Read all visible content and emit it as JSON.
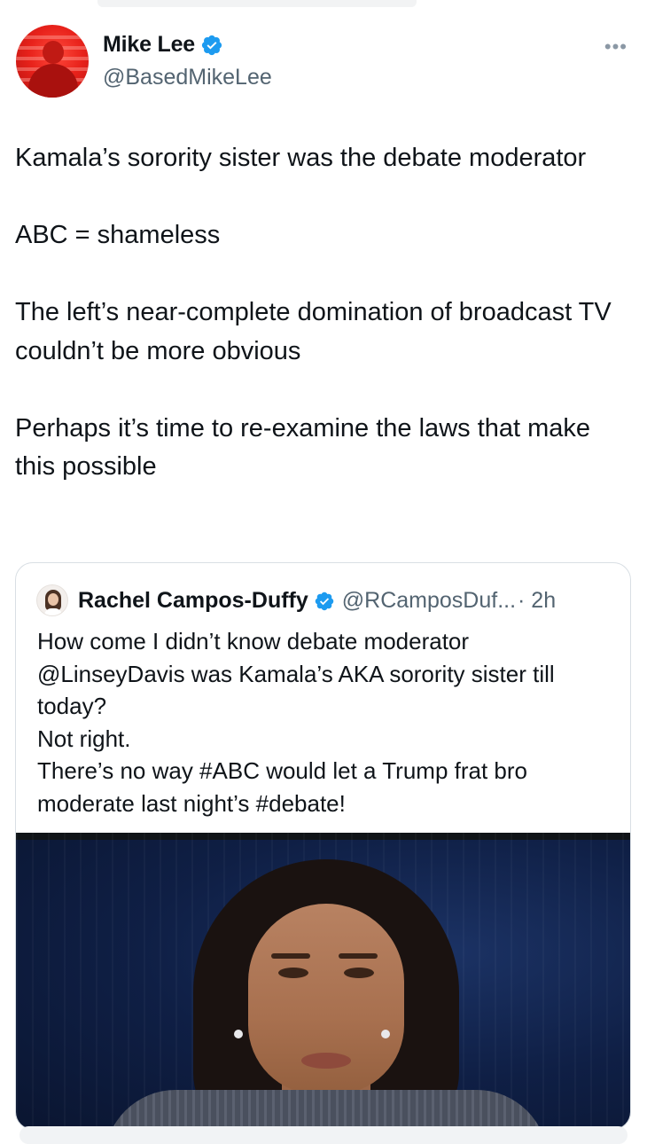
{
  "tweet": {
    "author_name": "Mike Lee",
    "author_handle": "@BasedMikeLee",
    "more_label": "•••",
    "text": "Kamala’s sorority sister was the debate moderator\n\nABC = shameless\n\nThe left’s near-complete domination of broadcast TV couldn’t be more obvious\n\nPerhaps it’s time to re-examine the laws that make this possible"
  },
  "quote": {
    "author_name": "Rachel Campos-Duffy",
    "author_handle": "@RCamposDuf...",
    "time": "· 2h",
    "text": "How come I didn’t know debate moderator @LinseyDavis was Kamala’s AKA sorority sister till today?\nNot right.\nThere’s no way #ABC would let a Trump frat bro moderate last night’s #debate!"
  },
  "colors": {
    "verified_blue": "#1d9bf0",
    "text_primary": "#0f1419",
    "text_secondary": "#536471",
    "border": "#d9dfe4"
  },
  "icons": {
    "verified": "verified-badge-icon",
    "more": "more-options-icon"
  }
}
